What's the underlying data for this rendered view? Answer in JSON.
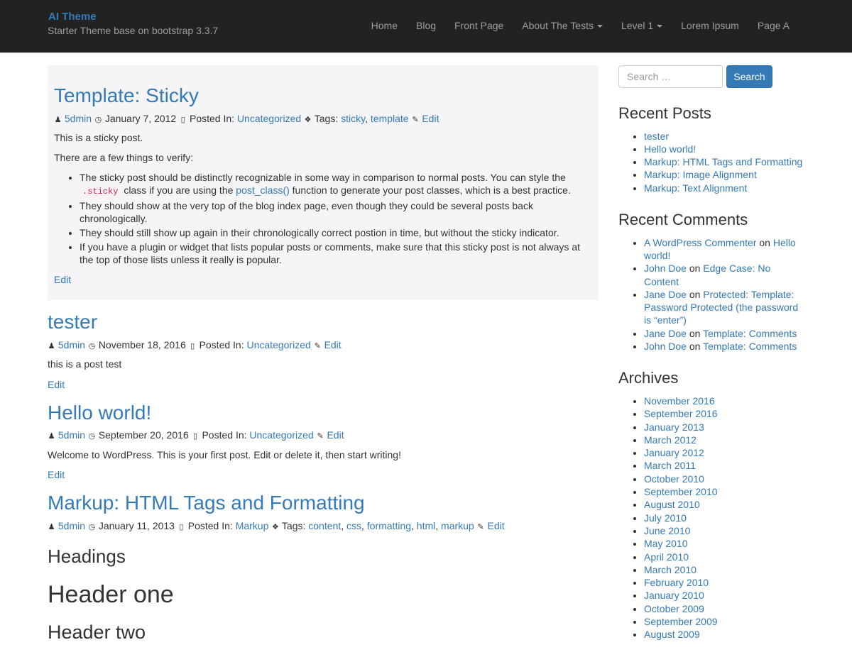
{
  "header": {
    "brand": "AI Theme",
    "tagline": "Starter Theme base on bootstrap 3.3.7",
    "nav": [
      {
        "label": "Home",
        "caret": false
      },
      {
        "label": "Blog",
        "caret": false
      },
      {
        "label": "Front Page",
        "caret": false
      },
      {
        "label": "About The Tests",
        "caret": true
      },
      {
        "label": "Level 1",
        "caret": true
      },
      {
        "label": "Lorem Ipsum",
        "caret": false
      },
      {
        "label": "Page A",
        "caret": false
      }
    ]
  },
  "common": {
    "posted_in": "Posted In:",
    "tags": "Tags:",
    "edit": "Edit",
    "comma": ","
  },
  "posts": {
    "sticky": {
      "title": "Template: Sticky",
      "author": "5dmin",
      "date": "January 7, 2012",
      "category": "Uncategorized",
      "tags": [
        "sticky",
        "template"
      ],
      "p1": "This is a sticky post.",
      "p2": "There are a few things to verify:",
      "li1_a": "The sticky post should be distinctly recognizable in some way in comparison to normal posts. You can style the",
      "li1_code": ".sticky",
      "li1_b": "class if you are using the",
      "li1_link": "post_class()",
      "li1_c": "function to generate your post classes, which is a best practice.",
      "li2": "They should show at the very top of the blog index page, even though they could be several posts back chronologically.",
      "li3": "They should still show up again in their chronologically correct postion in time, but without the sticky indicator.",
      "li4": "If you have a plugin or widget that lists popular posts or comments, make sure that this sticky post is not always at the top of those lists unless it really is popular."
    },
    "tester": {
      "title": "tester",
      "author": "5dmin",
      "date": "November 18, 2016",
      "category": "Uncategorized",
      "body": "this is a post test"
    },
    "hello": {
      "title": "Hello world!",
      "author": "5dmin",
      "date": "September 20, 2016",
      "category": "Uncategorized",
      "body": "Welcome to WordPress. This is your first post. Edit or delete it, then start writing!"
    },
    "markup": {
      "title": "Markup: HTML Tags and Formatting",
      "author": "5dmin",
      "date": "January 11, 2013",
      "category": "Markup",
      "tags": [
        "content",
        "css",
        "formatting",
        "html",
        "markup"
      ],
      "headings": "Headings",
      "header_one": "Header one",
      "header_two": "Header two"
    }
  },
  "sidebar": {
    "search": {
      "placeholder": "Search …",
      "button": "Search"
    },
    "recent_posts": {
      "title": "Recent Posts",
      "items": [
        "tester",
        "Hello world!",
        "Markup: HTML Tags and Formatting",
        "Markup: Image Alignment",
        "Markup: Text Alignment"
      ]
    },
    "recent_comments": {
      "title": "Recent Comments",
      "on": "on",
      "items": [
        {
          "author": "A WordPress Commenter",
          "post": "Hello world!"
        },
        {
          "author": "John Doe",
          "post": "Edge Case: No Content"
        },
        {
          "author": "Jane Doe",
          "post": "Protected: Template: Password Protected (the password is “enter”)"
        },
        {
          "author": "Jane Doe",
          "post": "Template: Comments"
        },
        {
          "author": "John Doe",
          "post": "Template: Comments"
        }
      ]
    },
    "archives": {
      "title": "Archives",
      "items": [
        "November 2016",
        "September 2016",
        "January 2013",
        "March 2012",
        "January 2012",
        "March 2011",
        "October 2010",
        "September 2010",
        "August 2010",
        "July 2010",
        "June 2010",
        "May 2010",
        "April 2010",
        "March 2010",
        "February 2010",
        "January 2010",
        "October 2009",
        "September 2009",
        "August 2009"
      ]
    }
  },
  "colors": {
    "navbar": "#222222",
    "link": "#337ab7",
    "sticky_bg": "#f5f5f8"
  }
}
